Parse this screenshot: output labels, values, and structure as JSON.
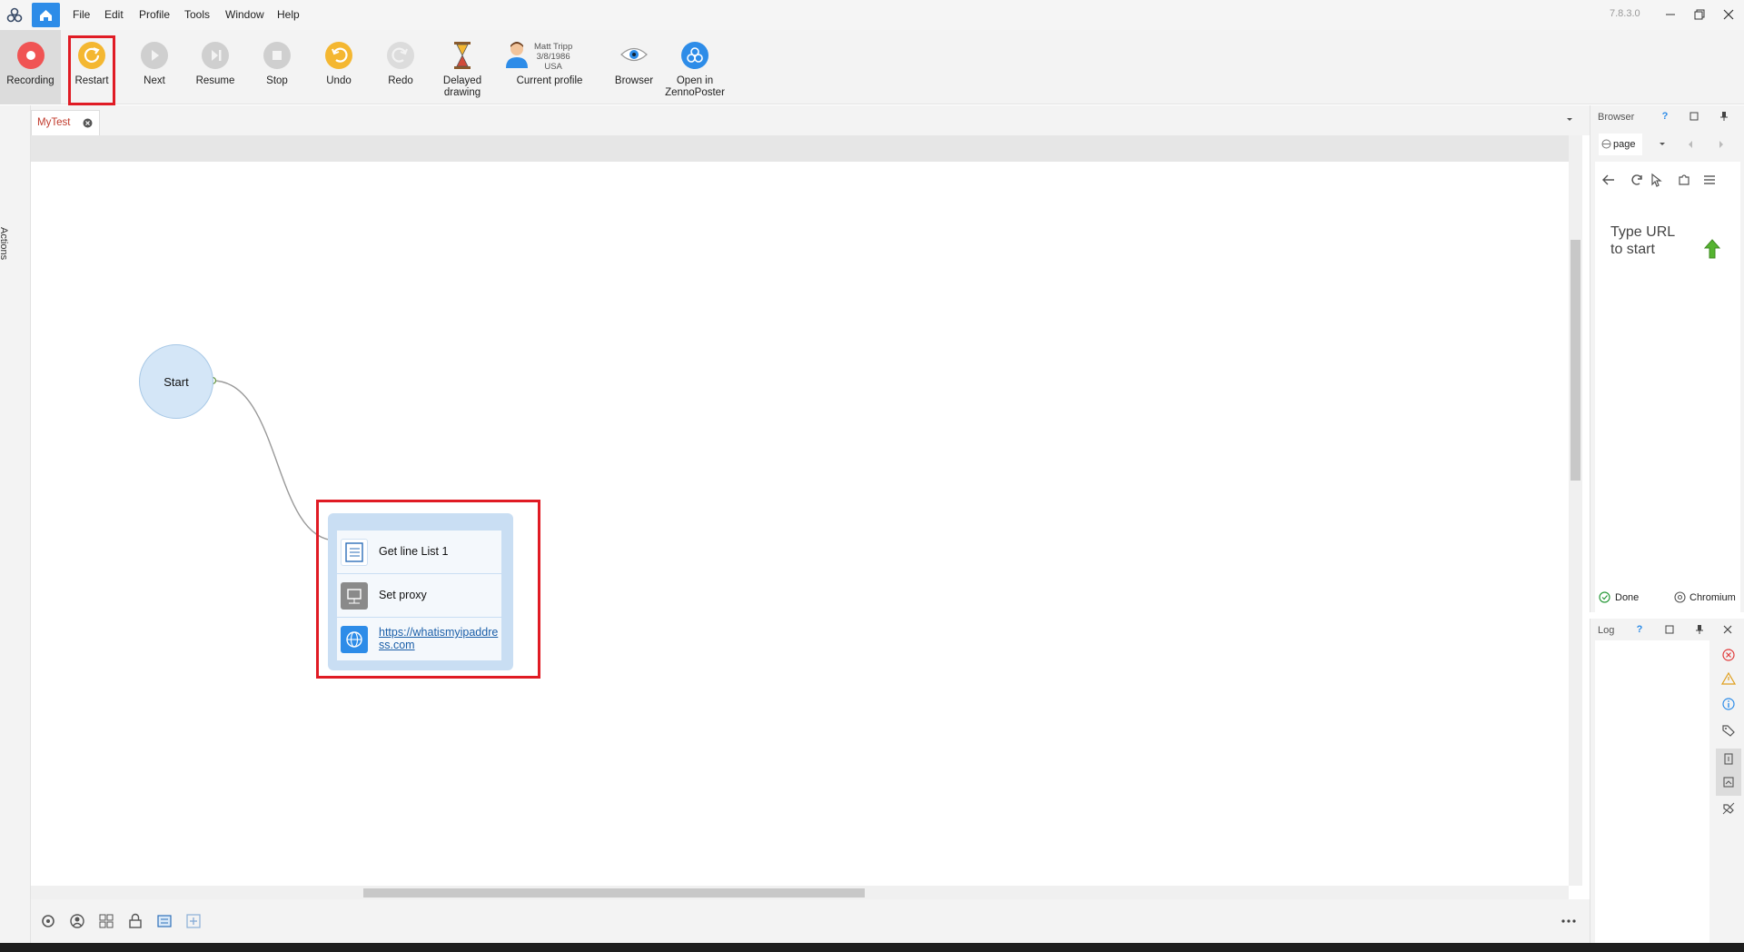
{
  "menu": {
    "items": [
      "File",
      "Edit",
      "Profile",
      "Tools",
      "Window",
      "Help"
    ],
    "version": "7.8.3.0"
  },
  "toolbar": {
    "recording": "Recording",
    "restart": "Restart",
    "next": "Next",
    "resume": "Resume",
    "stop": "Stop",
    "undo": "Undo",
    "redo": "Redo",
    "delayed_drawing": "Delayed drawing",
    "current_profile": "Current profile",
    "browser": "Browser",
    "open_in_zp": "Open in ZennoPoster",
    "profile": {
      "name": "Matt Tripp",
      "dob": "3/8/1986",
      "country": "USA"
    }
  },
  "sidebar": {
    "actions_label": "Actions"
  },
  "tabs": {
    "document": "MyTest"
  },
  "canvas": {
    "start_label": "Start",
    "actions": [
      {
        "label": "Get line List 1",
        "icon": "list-icon"
      },
      {
        "label": "Set proxy",
        "icon": "proxy-icon"
      },
      {
        "label": "https://whatismyipaddress.com",
        "icon": "globe-icon"
      }
    ]
  },
  "browser_panel": {
    "title": "Browser",
    "help": "?",
    "page_tab": "page",
    "placeholder": "Type URL to start",
    "status_done": "Done",
    "engine": "Chromium"
  },
  "log_panel": {
    "title": "Log",
    "help": "?"
  },
  "colors": {
    "accent": "#2d8ce8",
    "record_red": "#f05454",
    "restart_yellow": "#f4b731",
    "highlight_red": "#e01b24",
    "link": "#1a5ea8"
  }
}
